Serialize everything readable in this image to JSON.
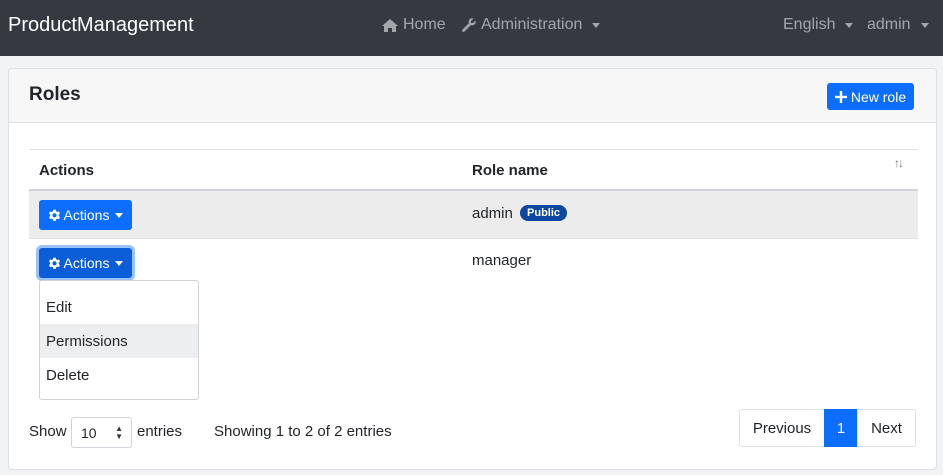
{
  "navbar": {
    "brand": "ProductManagement",
    "home": "Home",
    "administration": "Administration",
    "language": "English",
    "user": "admin"
  },
  "page": {
    "title": "Roles",
    "new_role_label": "New role"
  },
  "table": {
    "headers": {
      "actions": "Actions",
      "role_name": "Role name"
    },
    "rows": [
      {
        "actions_label": "Actions",
        "name": "admin",
        "badge": "Public"
      },
      {
        "actions_label": "Actions",
        "name": "manager"
      }
    ]
  },
  "dropdown": {
    "items": [
      "Edit",
      "Permissions",
      "Delete"
    ],
    "highlighted": "Permissions"
  },
  "footer": {
    "show_label": "Show",
    "page_size": "10",
    "entries_label": "entries",
    "info": "Showing 1 to 2 of 2 entries",
    "previous": "Previous",
    "current_page": "1",
    "next": "Next"
  },
  "colors": {
    "primary": "#0d6efd",
    "navbar": "#343a40",
    "badge": "#0d47a1"
  }
}
